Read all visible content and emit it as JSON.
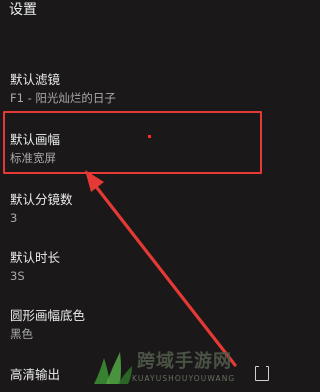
{
  "header": {
    "title": "设置"
  },
  "settings": [
    {
      "label": "默认滤镜",
      "value": "F1 - 阳光灿烂的日子"
    },
    {
      "label": "默认画幅",
      "value": "标准宽屏"
    },
    {
      "label": "默认分镜数",
      "value": "3"
    },
    {
      "label": "默认时长",
      "value": "3S"
    },
    {
      "label": "圆形画幅底色",
      "value": "黑色"
    },
    {
      "label": "高清输出",
      "value": ""
    }
  ],
  "annotation": {
    "highlight_color": "#e53935",
    "icon": "red-arrow-icon"
  },
  "watermark": {
    "text_cn": "跨域手游网",
    "text_en": "KUAYUSHOUYOUWANG"
  },
  "corner_icon": "checkbox-icon"
}
